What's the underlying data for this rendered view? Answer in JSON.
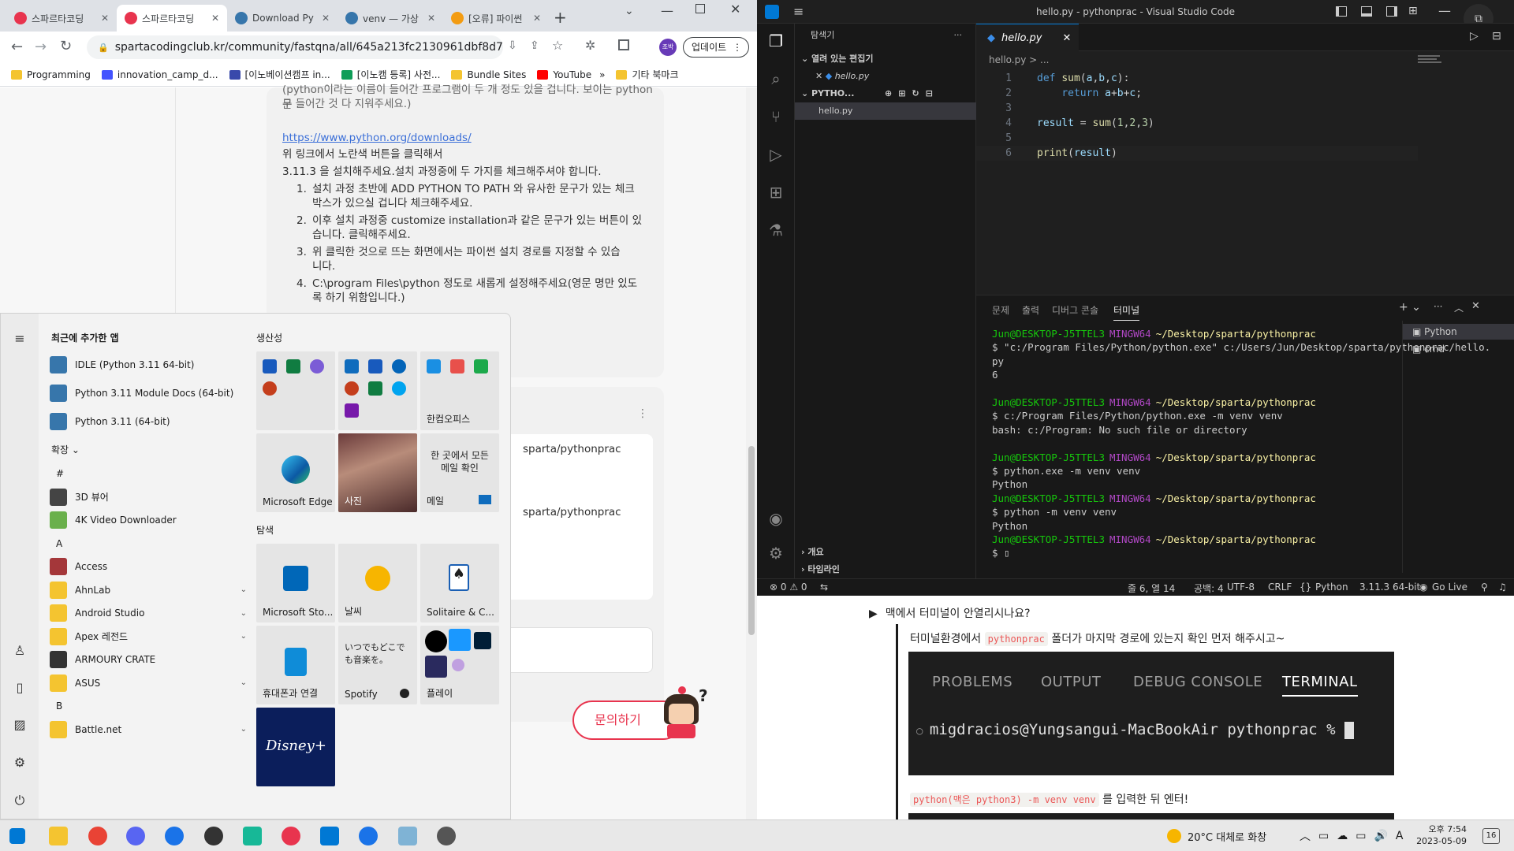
{
  "chrome": {
    "tabs": [
      {
        "label": "스파르타코딩",
        "active": false
      },
      {
        "label": "스파르타코딩",
        "active": true
      },
      {
        "label": "Download Py",
        "active": false
      },
      {
        "label": "venv — 가상",
        "active": false
      },
      {
        "label": "[오류] 파이썬",
        "active": false
      }
    ],
    "new_tab": "+",
    "url": "spartacodingclub.kr/community/fastqna/all/645a213fc2130961dbf8d726/v...",
    "update_button": "업데이트",
    "profile_initials": "조박",
    "bookmarks": [
      "Programming",
      "innovation_camp_d...",
      "[이노베이션캠프 in...",
      "[이노캠 등록] 사전...",
      "Bundle Sites",
      "YouTube",
      "기타 북마크"
    ],
    "page": {
      "intro_line1": "(python이라는 이름이 들어간 프로그램이 두 개 정도 있을 겁니다. 보이는 python 문",
      "intro_line2": "구 들어간 것 다 지워주세요.)",
      "link": "https://www.python.org/downloads/",
      "line_a": "위 링크에서 노란색 버튼을 클릭해서",
      "line_b": "3.11.3 을 설치해주세요.설치 과정중에 두 가지를 체크해주셔야 합니다.",
      "steps": [
        {
          "num": "1.",
          "l1": "설치 과정 초반에 ADD PYTHON TO PATH 와 유사한 문구가 있는 체크",
          "l2": "박스가 있으실 겁니다 체크해주세요."
        },
        {
          "num": "2.",
          "l1": "이후 설치 과정중 customize installation과 같은 문구가 있는 버튼이 있",
          "l2": "습니다. 클릭해주세요."
        },
        {
          "num": "3.",
          "l1": "위 클릭한 것으로 뜨는 화면에서는 파이썬 설치 경로를 지정할 수 있습",
          "l2": "니다."
        },
        {
          "num": "4.",
          "l1": "C:\\program Files\\python 정도로 새롭게 설정해주세요(영문 명만 있도",
          "l2": "록 하기 위함입니다.)"
        }
      ],
      "path_fragment_1": "sparta/pythonprac",
      "path_fragment_2": "sparta/pythonprac",
      "ask_button": "문의하기"
    }
  },
  "vscode": {
    "title": "hello.py - pythonprac - Visual Studio Code",
    "explorer_title": "탐색기",
    "open_editors": "열려 있는 편집기",
    "open_file": "hello.py",
    "folder": "PYTHO...",
    "folder_file": "hello.py",
    "outline": "개요",
    "timeline": "타임라인",
    "tab": "hello.py",
    "breadcrumb": "hello.py > ...",
    "code": [
      {
        "n": "1",
        "parts": [
          [
            "kw",
            "def "
          ],
          [
            "fn",
            "sum"
          ],
          [
            "",
            "("
          ],
          [
            "var",
            "a"
          ],
          [
            "",
            ","
          ],
          [
            "var",
            "b"
          ],
          [
            "",
            ","
          ],
          [
            "var",
            "c"
          ],
          [
            "",
            "):"
          ]
        ]
      },
      {
        "n": "2",
        "parts": [
          [
            "",
            "    "
          ],
          [
            "kw",
            "return "
          ],
          [
            "var",
            "a"
          ],
          [
            "",
            "+"
          ],
          [
            "var",
            "b"
          ],
          [
            "",
            "+"
          ],
          [
            "var",
            "c"
          ],
          [
            "",
            ";"
          ]
        ]
      },
      {
        "n": "3",
        "parts": []
      },
      {
        "n": "4",
        "parts": [
          [
            "var",
            "result"
          ],
          [
            "",
            " = "
          ],
          [
            "fn",
            "sum"
          ],
          [
            "",
            "("
          ],
          [
            "num",
            "1"
          ],
          [
            "",
            ","
          ],
          [
            "num",
            "2"
          ],
          [
            "",
            ","
          ],
          [
            "num",
            "3"
          ],
          [
            "",
            ")"
          ]
        ]
      },
      {
        "n": "5",
        "parts": []
      },
      {
        "n": "6",
        "parts": [
          [
            "fn",
            "print"
          ],
          [
            "",
            "("
          ],
          [
            "var",
            "result"
          ],
          [
            "",
            ")"
          ]
        ]
      }
    ],
    "panel_tabs": [
      "문제",
      "출력",
      "디버그 콘솔",
      "터미널"
    ],
    "terminal_list": [
      "Python",
      "cmd"
    ],
    "terminal": [
      {
        "type": "prompt",
        "user": "Jun@DESKTOP-J5TTEL3",
        "env": "MINGW64",
        "path": "~/Desktop/sparta/pythonprac"
      },
      {
        "type": "text",
        "text": "$ \"c:/Program Files/Python/python.exe\" c:/Users/Jun/Desktop/sparta/pythonprac/hello."
      },
      {
        "type": "text",
        "text": "py"
      },
      {
        "type": "text",
        "text": "6"
      },
      {
        "type": "blank"
      },
      {
        "type": "prompt",
        "user": "Jun@DESKTOP-J5TTEL3",
        "env": "MINGW64",
        "path": "~/Desktop/sparta/pythonprac"
      },
      {
        "type": "text",
        "text": "$ c:/Program Files/Python/python.exe -m venv venv"
      },
      {
        "type": "text",
        "text": "bash: c:/Program: No such file or directory"
      },
      {
        "type": "blank"
      },
      {
        "type": "prompt",
        "user": "Jun@DESKTOP-J5TTEL3",
        "env": "MINGW64",
        "path": "~/Desktop/sparta/pythonprac"
      },
      {
        "type": "text",
        "text": "$ python.exe -m venv venv"
      },
      {
        "type": "text",
        "text": "Python"
      },
      {
        "type": "prompt",
        "user": "Jun@DESKTOP-J5TTEL3",
        "env": "MINGW64",
        "path": "~/Desktop/sparta/pythonprac"
      },
      {
        "type": "text",
        "text": "$ python -m venv venv"
      },
      {
        "type": "text",
        "text": "Python"
      },
      {
        "type": "prompt",
        "user": "Jun@DESKTOP-J5TTEL3",
        "env": "MINGW64",
        "path": "~/Desktop/sparta/pythonprac"
      },
      {
        "type": "text",
        "text": "$ ▯"
      }
    ],
    "status": {
      "errors": "⊗ 0 ⚠ 0",
      "position": "줄 6, 열 14",
      "spaces": "공백: 4",
      "encoding": "UTF-8",
      "eol": "CRLF",
      "language": "Python",
      "interpreter": "3.11.3 64-bit",
      "golive": "Go Live"
    }
  },
  "notion": {
    "toggle": "맥에서 터미널이 안열리시나요?",
    "desc_prefix": "터미널환경에서",
    "desc_code": "pythonprac",
    "desc_suffix": "폴더가 마지막 경로에 있는지 확인 먼저 해주시고~",
    "term_tabs": [
      "PROBLEMS",
      "OUTPUT",
      "DEBUG CONSOLE",
      "TERMINAL"
    ],
    "term_prompt": "migdracios@Yungsangui-MacBookAir pythonprac % ",
    "cmd_code": "python(맥은 python3) -m venv venv",
    "cmd_suffix": "를 입력한 뒤 엔터!"
  },
  "startmenu": {
    "recent_title": "최근에 추가한 앱",
    "recent": [
      "IDLE (Python 3.11 64-bit)",
      "Python 3.11 Module Docs (64-bit)",
      "Python 3.11 (64-bit)"
    ],
    "expand": "확장",
    "sections": [
      {
        "letter": "#",
        "apps": [
          {
            "name": "3D 뷰어",
            "color": "#444444",
            "chev": false
          },
          {
            "name": "4K Video Downloader",
            "color": "#6ab04c",
            "chev": false
          }
        ]
      },
      {
        "letter": "A",
        "apps": [
          {
            "name": "Access",
            "color": "#a4373a",
            "chev": false
          },
          {
            "name": "AhnLab",
            "color": "#f4c430",
            "chev": true
          },
          {
            "name": "Android Studio",
            "color": "#f4c430",
            "chev": true
          },
          {
            "name": "Apex 레전드",
            "color": "#f4c430",
            "chev": true
          },
          {
            "name": "ARMOURY CRATE",
            "color": "#333333",
            "chev": false
          },
          {
            "name": "ASUS",
            "color": "#f4c430",
            "chev": true
          }
        ]
      },
      {
        "letter": "B",
        "apps": [
          {
            "name": "Battle.net",
            "color": "#f4c430",
            "chev": true
          }
        ]
      }
    ],
    "group1": "생산성",
    "group2": "탐색",
    "tiles": {
      "hancom": "한컴오피스",
      "edge": "Microsoft Edge",
      "photos": "사진",
      "mail_desc": "한 곳에서 모든 메일 확인",
      "mail": "메일",
      "store": "Microsoft Sto...",
      "weather": "날씨",
      "solitaire": "Solitaire & C...",
      "phone": "휴대폰과 연결",
      "spotify_desc": "いつでもどこでも音楽を。",
      "spotify": "Spotify",
      "play": "플레이",
      "disney": "Disney+"
    }
  },
  "taskbar": {
    "weather": "20°C  대체로 화창",
    "ime": "A",
    "time": "오후 7:54",
    "date": "2023-05-09",
    "badge": "16"
  }
}
